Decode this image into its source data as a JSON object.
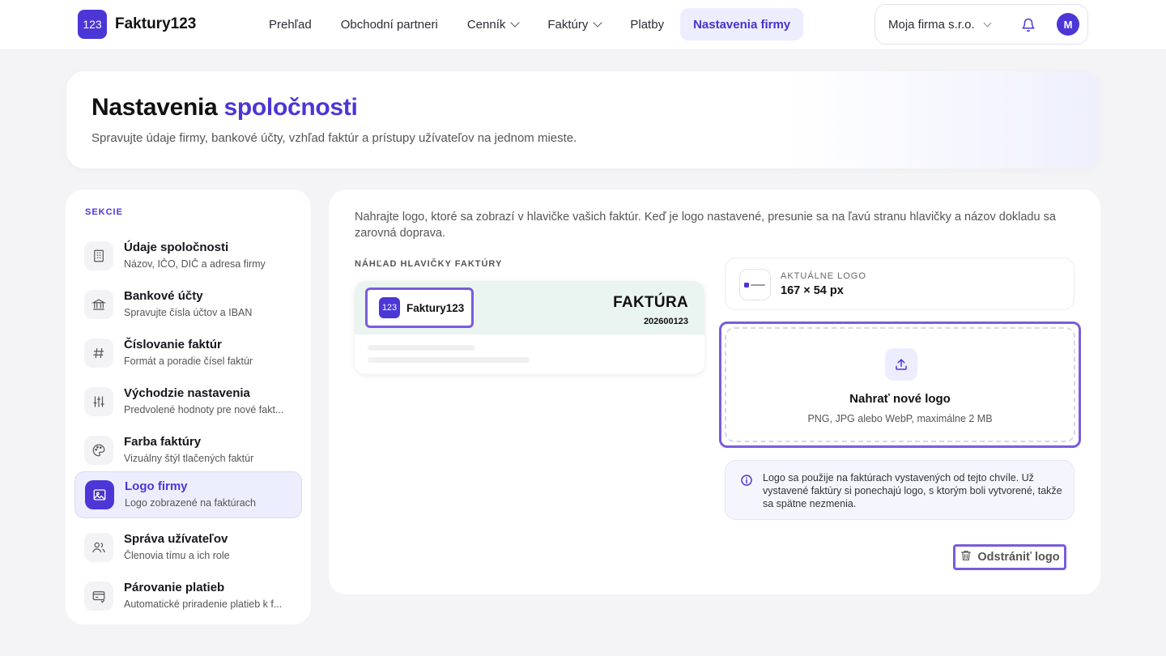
{
  "brand": {
    "badge": "123",
    "name": "Faktury123"
  },
  "nav": [
    {
      "label": "Prehľad",
      "dropdown": false,
      "active": false
    },
    {
      "label": "Obchodní partneri",
      "dropdown": false,
      "active": false
    },
    {
      "label": "Cenník",
      "dropdown": true,
      "active": false
    },
    {
      "label": "Faktúry",
      "dropdown": true,
      "active": false
    },
    {
      "label": "Platby",
      "dropdown": false,
      "active": false
    },
    {
      "label": "Nastavenia firmy",
      "dropdown": false,
      "active": true
    }
  ],
  "company": {
    "name": "Moja firma s.r.o.",
    "avatar": "M"
  },
  "hero": {
    "title_plain": "Nastavenia ",
    "title_accent": "spoločnosti",
    "subtitle": "Spravujte údaje firmy, bankové účty, vzhľad faktúr a prístupy užívateľov na jednom mieste."
  },
  "sidebar": {
    "title": "SEKCIE",
    "items": [
      {
        "label": "Údaje spoločnosti",
        "sub": "Názov, IČO, DIČ a adresa firmy",
        "icon": "building-icon",
        "active": false
      },
      {
        "label": "Bankové účty",
        "sub": "Spravujte čísla účtov a IBAN",
        "icon": "bank-icon",
        "active": false
      },
      {
        "label": "Číslovanie faktúr",
        "sub": "Formát a poradie čísel faktúr",
        "icon": "hash-icon",
        "active": false
      },
      {
        "label": "Východzie nastavenia",
        "sub": "Predvolené hodnoty pre nové fakt...",
        "icon": "sliders-icon",
        "active": false
      },
      {
        "label": "Farba faktúry",
        "sub": "Vizuálny štýl tlačených faktúr",
        "icon": "palette-icon",
        "active": false
      },
      {
        "label": "Logo firmy",
        "sub": "Logo zobrazené na faktúrach",
        "icon": "image-icon",
        "active": true
      },
      {
        "label": "Správa užívateľov",
        "sub": "Členovia tímu a ich role",
        "icon": "users-icon",
        "active": false
      },
      {
        "label": "Párovanie platieb",
        "sub": "Automatické priradenie platieb k f...",
        "icon": "card-icon",
        "active": false
      }
    ]
  },
  "main": {
    "intro": "Nahrajte logo, ktoré sa zobrazí v hlavičke vašich faktúr. Keď je logo nastavené, presunie sa na ľavú stranu hlavičky a názov dokladu sa zarovná doprava.",
    "preview_caption": "NÁHĽAD HLAVIČKY FAKTÚRY",
    "preview": {
      "badge": "123",
      "name": "Faktury123",
      "doc_title": "FAKTÚRA",
      "doc_number": "202600123"
    },
    "current_logo": {
      "caption": "AKTUÁLNE LOGO",
      "size": "167 × 54 px"
    },
    "upload": {
      "title": "Nahrať nové logo",
      "subtitle": "PNG, JPG alebo WebP, maximálne 2 MB"
    },
    "info": "Logo sa použije na faktúrach vystavených od tejto chvíle. Už vystavené faktúry si ponechajú logo, s ktorým boli vytvorené, takže sa spätne nezmenia.",
    "remove_label": "Odstrániť logo"
  },
  "colors": {
    "accent": "#4b36d6",
    "highlight": "#7a5cdc",
    "preview_header": "#eaf4f1"
  }
}
